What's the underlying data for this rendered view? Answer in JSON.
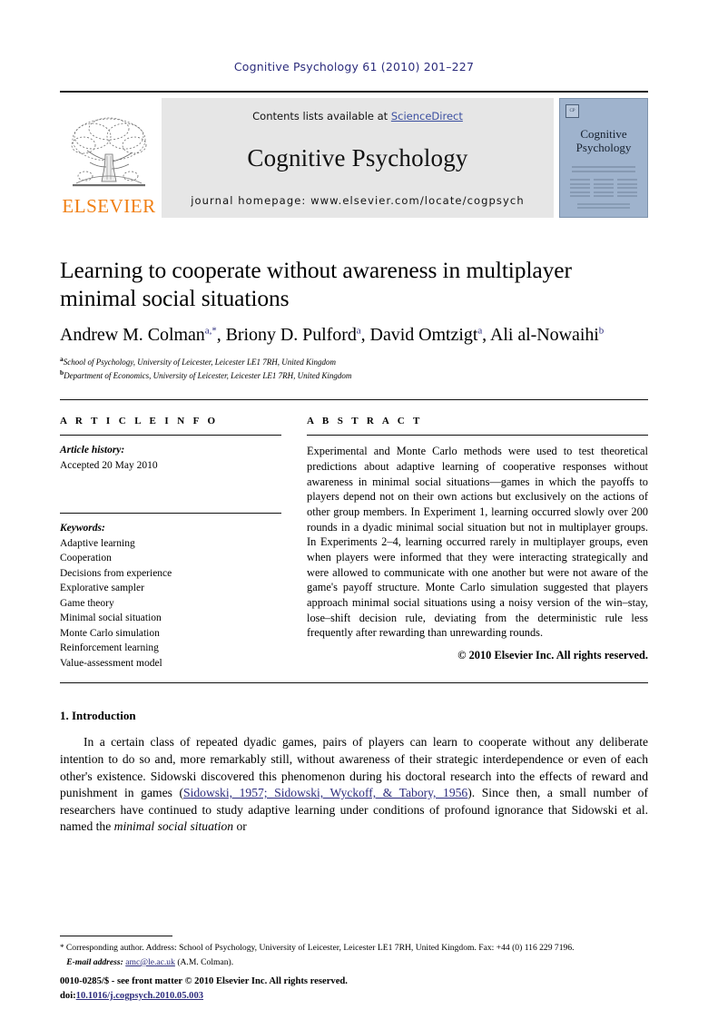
{
  "running_head": "Cognitive Psychology 61 (2010) 201–227",
  "masthead": {
    "publisher_name": "ELSEVIER",
    "publisher_logo_icon": "elsevier-tree-icon",
    "contents_prefix": "Contents lists available at ",
    "contents_link": "ScienceDirect",
    "journal_title": "Cognitive Psychology",
    "homepage": "journal homepage: www.elsevier.com/locate/cogpsych",
    "cover": {
      "badge": "CP",
      "title_line1": "Cognitive",
      "title_line2": "Psychology"
    }
  },
  "article": {
    "title": "Learning to cooperate without awareness in multiplayer minimal social situations",
    "authors": [
      {
        "name": "Andrew M. Colman",
        "marks": "a,*"
      },
      {
        "name": "Briony D. Pulford",
        "marks": "a"
      },
      {
        "name": "David Omtzigt",
        "marks": "a"
      },
      {
        "name": "Ali al-Nowaihi",
        "marks": "b"
      }
    ],
    "affiliations": [
      {
        "mark": "a",
        "text": "School of Psychology, University of Leicester, Leicester LE1 7RH, United Kingdom"
      },
      {
        "mark": "b",
        "text": "Department of Economics, University of Leicester, Leicester LE1 7RH, United Kingdom"
      }
    ]
  },
  "info": {
    "heading": "A R T I C L E   I N F O",
    "history_label": "Article history:",
    "history_value": "Accepted 20 May 2010",
    "keywords_label": "Keywords:",
    "keywords": [
      "Adaptive learning",
      "Cooperation",
      "Decisions from experience",
      "Explorative sampler",
      "Game theory",
      "Minimal social situation",
      "Monte Carlo simulation",
      "Reinforcement learning",
      "Value-assessment model"
    ]
  },
  "abstract": {
    "heading": "A B S T R A C T",
    "text": "Experimental and Monte Carlo methods were used to test theoretical predictions about adaptive learning of cooperative responses without awareness in minimal social situations—games in which the payoffs to players depend not on their own actions but exclusively on the actions of other group members. In Experiment 1, learning occurred slowly over 200 rounds in a dyadic minimal social situation but not in multiplayer groups. In Experiments 2–4, learning occurred rarely in multiplayer groups, even when players were informed that they were interacting strategically and were allowed to communicate with one another but were not aware of the game's payoff structure. Monte Carlo simulation suggested that players approach minimal social situations using a noisy version of the win–stay, lose–shift decision rule, deviating from the deterministic rule less frequently after rewarding than unrewarding rounds.",
    "copyright": "© 2010 Elsevier Inc. All rights reserved."
  },
  "body": {
    "section_title": "1. Introduction",
    "paragraph_1a": "In a certain class of repeated dyadic games, pairs of players can learn to cooperate without any deliberate intention to do so and, more remarkably still, without awareness of their strategic interdependence or even of each other's existence. Sidowski discovered this phenomenon during his doctoral research into the effects of reward and punishment in games (",
    "citation_1": "Sidowski, 1957; Sidowski, Wyckoff, & Tabory, 1956",
    "paragraph_1b": "). Since then, a small number of researchers have continued to study adaptive learning under conditions of profound ignorance that Sidowski et al. named the ",
    "paragraph_1_italic": "minimal social situation",
    "paragraph_1c": " or"
  },
  "footnotes": {
    "corresponding": "Corresponding author. Address: School of Psychology, University of Leicester, Leicester LE1 7RH, United Kingdom. Fax: +44 (0) 116 229 7196.",
    "email_label": "E-mail address:",
    "email_value": "amc@le.ac.uk",
    "email_owner": "(A.M. Colman)."
  },
  "footer": {
    "issn_line": "0010-0285/$ - see front matter © 2010 Elsevier Inc. All rights reserved.",
    "doi_prefix": "doi:",
    "doi_value": "10.1016/j.cogpsych.2010.05.003"
  },
  "colors": {
    "link_blue": "#2c2c7c",
    "elsevier_orange": "#f07f13",
    "masthead_gray": "#e6e6e6",
    "cover_blue": "#9fb3cd"
  }
}
